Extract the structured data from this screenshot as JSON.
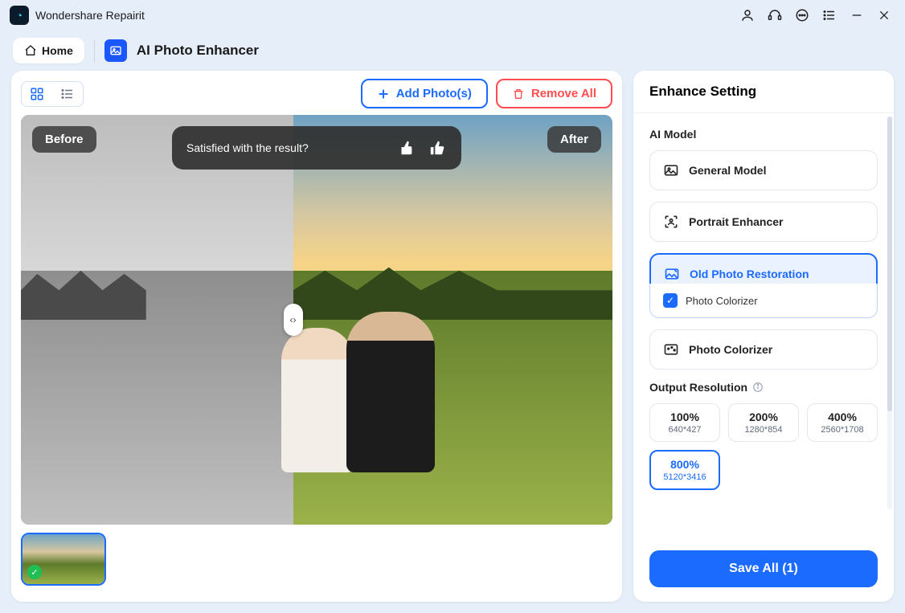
{
  "app_name": "Wondershare Repairit",
  "home_label": "Home",
  "page_title": "AI Photo Enhancer",
  "toolbar": {
    "add_label": "Add Photo(s)",
    "remove_label": "Remove All"
  },
  "preview": {
    "before_label": "Before",
    "after_label": "After",
    "feedback_question": "Satisfied with the result?"
  },
  "enhance": {
    "title": "Enhance Setting",
    "ai_model_title": "AI Model",
    "models": {
      "general": "General Model",
      "portrait": "Portrait Enhancer",
      "old_photo": "Old Photo Restoration",
      "colorizer_sub": "Photo Colorizer",
      "colorizer": "Photo Colorizer"
    },
    "output_title": "Output Resolution",
    "resolutions": [
      {
        "pct": "100%",
        "dim": "640*427"
      },
      {
        "pct": "200%",
        "dim": "1280*854"
      },
      {
        "pct": "400%",
        "dim": "2560*1708"
      },
      {
        "pct": "800%",
        "dim": "5120*3416"
      }
    ],
    "save_label": "Save All (1)"
  }
}
